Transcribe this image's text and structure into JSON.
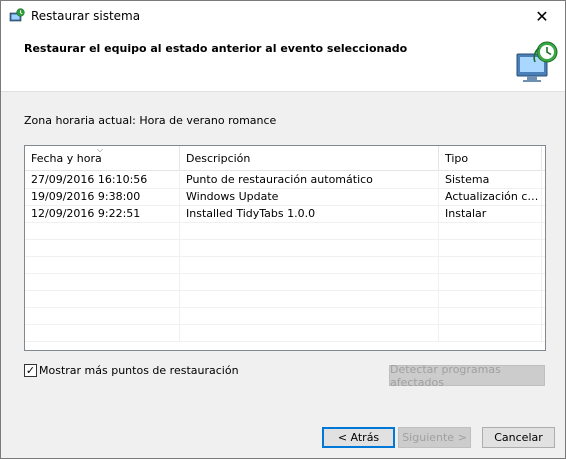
{
  "window": {
    "title": "Restaurar sistema",
    "close_glyph": "✕"
  },
  "header": {
    "title": "Restaurar el equipo al estado anterior al evento seleccionado",
    "icon": "system-restore-icon"
  },
  "timezone_label": "Zona horaria actual: Hora de verano romance",
  "table": {
    "columns": [
      "Fecha y hora",
      "Descripción",
      "Tipo"
    ],
    "sort_glyph": "⌵",
    "rows": [
      {
        "date": "27/09/2016 16:10:56",
        "description": "Punto de restauración automático",
        "type": "Sistema"
      },
      {
        "date": "19/09/2016 9:38:00",
        "description": "Windows Update",
        "type": "Actualización crí..."
      },
      {
        "date": "12/09/2016 9:22:51",
        "description": "Installed TidyTabs 1.0.0",
        "type": "Instalar"
      }
    ]
  },
  "show_more": {
    "label": "Mostrar más puntos de restauración",
    "checked": true,
    "check_glyph": "✓"
  },
  "buttons": {
    "detect": "Detectar programas afectados",
    "back": "< Atrás",
    "next": "Siguiente >",
    "cancel": "Cancelar"
  },
  "colors": {
    "accent": "#0078d7",
    "disabled_text": "#a0a0a0"
  }
}
